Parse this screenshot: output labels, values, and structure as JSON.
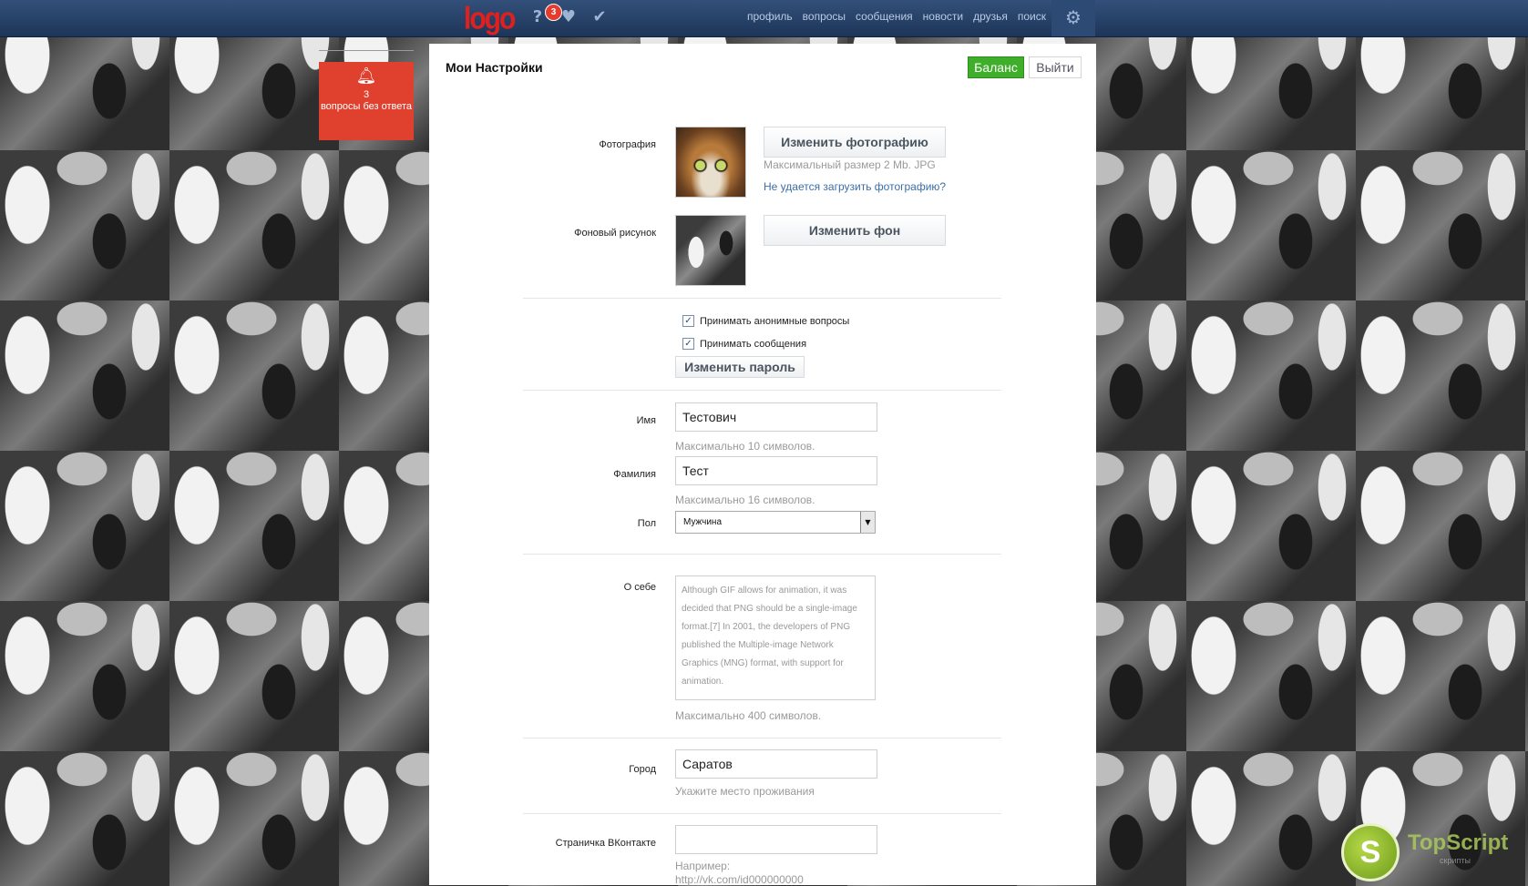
{
  "topbar": {
    "logo": "logo",
    "notification_count": "3",
    "nav": [
      "профиль",
      "вопросы",
      "сообщения",
      "новости",
      "друзья",
      "поиск"
    ]
  },
  "notify": {
    "count": "3",
    "text": "вопросы без ответа"
  },
  "panel": {
    "title": "Мои Настройки",
    "balance_label": "Баланс",
    "exit_label": "Выйти"
  },
  "photo": {
    "label": "Фотография",
    "button": "Изменить фотографию",
    "hint": "Максимальный размер 2 Mb. JPG",
    "help_link": "Не удается загрузить фотографию?"
  },
  "background": {
    "label": "Фоновый рисунок",
    "button": "Изменить фон"
  },
  "options": {
    "anon_questions": "Принимать анонимные вопросы",
    "messages": "Принимать сообщения",
    "change_password": "Изменить пароль"
  },
  "name": {
    "label": "Имя",
    "value": "Тестович",
    "hint": "Максимально 10 символов."
  },
  "surname": {
    "label": "Фамилия",
    "value": "Тест",
    "hint": "Максимально 16 символов."
  },
  "gender": {
    "label": "Пол",
    "value": "Мужчина"
  },
  "about": {
    "label": "О себе",
    "value": "Although GIF allows for animation, it was decided that PNG should be a single-image format.[7] In 2001, the developers of PNG published the Multiple-image Network Graphics (MNG) format, with support for animation.",
    "hint": "Максимально 400 символов."
  },
  "city": {
    "label": "Город",
    "value": "Саратов",
    "hint": "Укажите место проживания"
  },
  "vk": {
    "label": "Страничка ВКонтакте",
    "value": "",
    "hint_prefix": "Например:",
    "hint_example": "http://vk.com/id000000000"
  },
  "watermark": {
    "letter": "S",
    "text": "TopScript",
    "sub": "скрипты"
  },
  "colors": {
    "topbar": "#1d3558",
    "accent_red": "#e0412f",
    "balance_green": "#3fae2a",
    "link_blue": "#3b6ea8"
  }
}
